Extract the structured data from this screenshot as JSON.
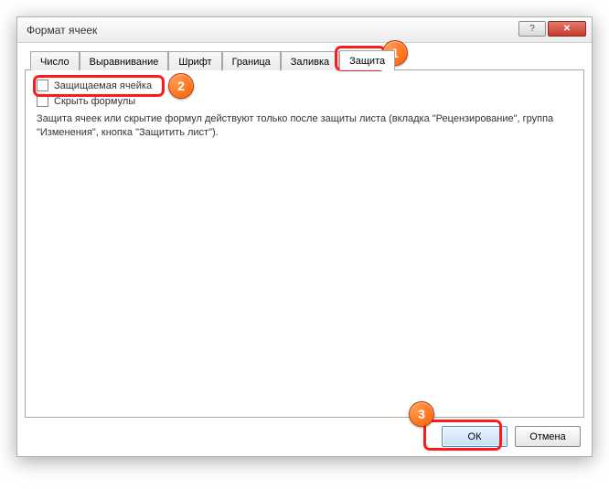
{
  "window": {
    "title": "Формат ячеек",
    "help_char": "?",
    "close_char": "✕"
  },
  "tabs": [
    {
      "label": "Число"
    },
    {
      "label": "Выравнивание"
    },
    {
      "label": "Шрифт"
    },
    {
      "label": "Граница"
    },
    {
      "label": "Заливка"
    },
    {
      "label": "Защита"
    }
  ],
  "active_tab_index": 5,
  "protection": {
    "cb_locked": "Защищаемая ячейка",
    "cb_hidden": "Скрыть формулы",
    "description": "Защита ячеек или скрытие формул действуют только после защиты листа (вкладка \"Рецензирование\", группа \"Изменения\", кнопка \"Защитить лист\")."
  },
  "buttons": {
    "ok": "ОК",
    "cancel": "Отмена"
  },
  "badges": {
    "b1": "1",
    "b2": "2",
    "b3": "3"
  }
}
